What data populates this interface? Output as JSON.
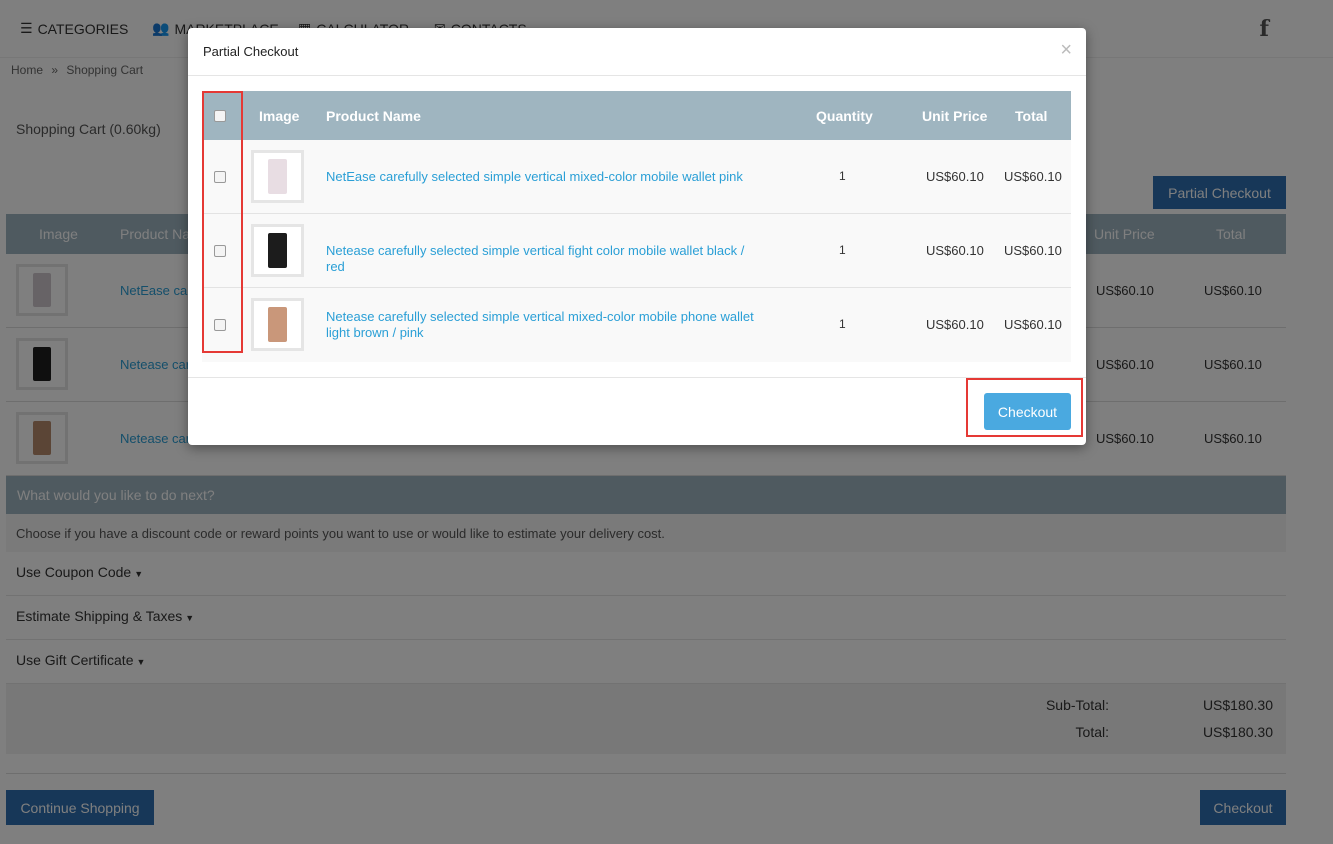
{
  "nav": {
    "items": [
      {
        "label": "CATEGORIES",
        "icon": "list-icon"
      },
      {
        "label": "MARKETPLACE",
        "icon": "users-icon"
      },
      {
        "label": "CALCULATOR",
        "icon": "calculator-icon"
      },
      {
        "label": "CONTACTS",
        "icon": "envelope-icon"
      }
    ],
    "social": "f"
  },
  "breadcrumb": {
    "home": "Home",
    "sep": "»",
    "current": "Shopping Cart"
  },
  "page": {
    "title": "Shopping Cart  (0.60kg)",
    "partial_checkout_label": "Partial Checkout"
  },
  "cart": {
    "columns": {
      "image": "Image",
      "name": "Product Na",
      "unit_price": "Unit Price",
      "total": "Total"
    },
    "rows": [
      {
        "name": "NetEase car",
        "unit_price": "US$60.10",
        "total": "US$60.10",
        "color": "#cfc6cc"
      },
      {
        "name": "Netease car",
        "unit_price": "US$60.10",
        "total": "US$60.10",
        "color": "#1f1f1f"
      },
      {
        "name": "Netease car",
        "unit_price": "US$60.10",
        "total": "US$60.10",
        "color": "#b68a6c"
      }
    ]
  },
  "next": {
    "heading": "What would you like to do next?",
    "description": "Choose if you have a discount code or reward points you want to use or would like to estimate your delivery cost.",
    "coupon": "Use Coupon Code",
    "shipping": "Estimate Shipping & Taxes",
    "gift": "Use Gift Certificate"
  },
  "totals": {
    "subtotal_label": "Sub-Total:",
    "subtotal_value": "US$180.30",
    "total_label": "Total:",
    "total_value": "US$180.30"
  },
  "buttons": {
    "continue": "Continue Shopping",
    "checkout": "Checkout"
  },
  "modal": {
    "title": "Partial Checkout",
    "close": "×",
    "columns": {
      "image": "Image",
      "name": "Product Name",
      "quantity": "Quantity",
      "unit_price": "Unit Price",
      "total": "Total"
    },
    "rows": [
      {
        "name": "NetEase carefully selected simple vertical mixed-color mobile wallet pink",
        "quantity": "1",
        "unit_price": "US$60.10",
        "total": "US$60.10",
        "color": "#e8dde3"
      },
      {
        "name": "Netease carefully selected simple vertical fight color mobile wallet black / red",
        "quantity": "1",
        "unit_price": "US$60.10",
        "total": "US$60.10",
        "color": "#1c1c1c"
      },
      {
        "name": "Netease carefully selected simple vertical mixed-color mobile phone wallet light brown / pink",
        "quantity": "1",
        "unit_price": "US$60.10",
        "total": "US$60.10",
        "color": "#c9977a"
      }
    ],
    "checkout_label": "Checkout"
  },
  "colors": {
    "accent": "#2f6fb1",
    "link": "#2a9fd6",
    "table_header": "#9fb5c0",
    "highlight": "#e53935",
    "modal_button": "#4aa9e0"
  }
}
